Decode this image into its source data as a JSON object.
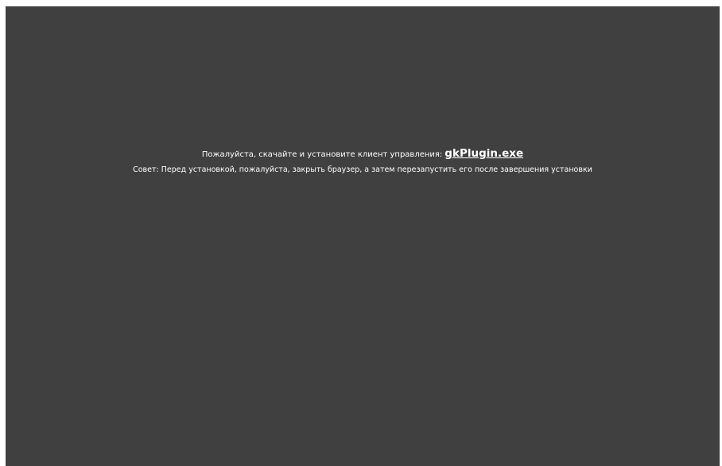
{
  "colors": {
    "background": "#404040",
    "text": "#ffffff"
  },
  "prompt": {
    "text": "Пожалуйста, скачайте и установите клиент управления:",
    "link_label": "gkPlugin.exe"
  },
  "tip": {
    "text": "Совет: Перед установкой, пожалуйста, закрыть браузер, а затем перезапустить его после завершения установки"
  }
}
